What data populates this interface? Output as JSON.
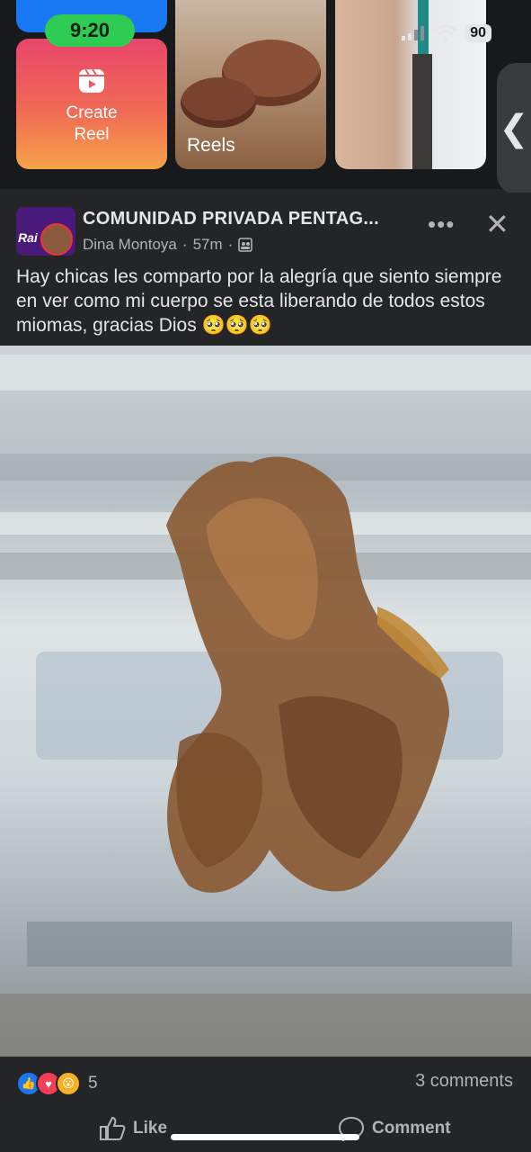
{
  "status_bar": {
    "time": "9:20",
    "battery": "90"
  },
  "reels_tray": {
    "create_label": "Create\nReel",
    "reels_label": "Reels",
    "side_arrow": "❮"
  },
  "post": {
    "group_name": "COMUNIDAD PRIVADA PENTAG...",
    "author": "Dina Montoya",
    "time": "57m",
    "text": "Hay chicas les comparto por la alegría que siento siempre en ver como mi cuerpo se esta liberando de todos estos miomas, gracias Dios 🥺🥺🥺",
    "more_icon": "•••",
    "close_icon": "✕"
  },
  "engagement": {
    "reaction_count": "5",
    "comments": "3 comments",
    "like_label": "Like",
    "comment_label": "Comment"
  }
}
